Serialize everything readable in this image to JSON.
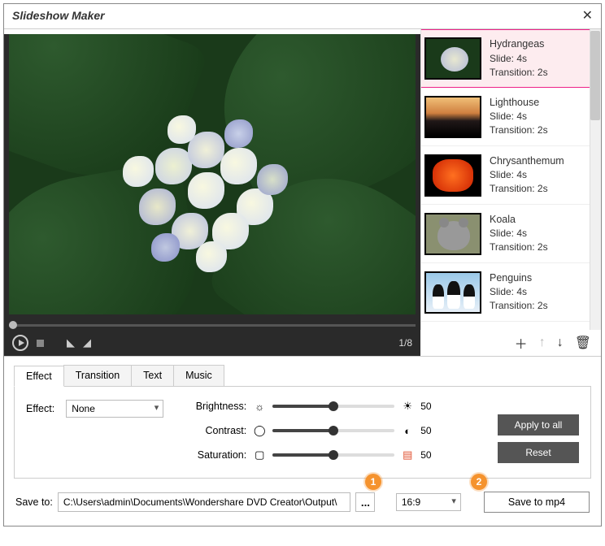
{
  "window": {
    "title": "Slideshow Maker"
  },
  "preview": {
    "counter": "1/8"
  },
  "thumbs": [
    {
      "name": "Hydrangeas",
      "slide": "Slide: 4s",
      "transition": "Transition: 2s",
      "selected": true
    },
    {
      "name": "Lighthouse",
      "slide": "Slide: 4s",
      "transition": "Transition: 2s",
      "selected": false
    },
    {
      "name": "Chrysanthemum",
      "slide": "Slide: 4s",
      "transition": "Transition: 2s",
      "selected": false
    },
    {
      "name": "Koala",
      "slide": "Slide: 4s",
      "transition": "Transition: 2s",
      "selected": false
    },
    {
      "name": "Penguins",
      "slide": "Slide: 4s",
      "transition": "Transition: 2s",
      "selected": false
    }
  ],
  "tabs": {
    "t0": "Effect",
    "t1": "Transition",
    "t2": "Text",
    "t3": "Music"
  },
  "effect": {
    "label": "Effect:",
    "dropdown": "None",
    "brightness_label": "Brightness:",
    "contrast_label": "Contrast:",
    "saturation_label": "Saturation:",
    "brightness_val": "50",
    "contrast_val": "50",
    "saturation_val": "50",
    "apply_all": "Apply to all",
    "reset": "Reset"
  },
  "save": {
    "label": "Save to:",
    "path": "C:\\Users\\admin\\Documents\\Wondershare DVD Creator\\Output\\",
    "browse": "...",
    "ratio": "16:9",
    "button": "Save to mp4"
  },
  "anno": {
    "a1": "1",
    "a2": "2"
  }
}
